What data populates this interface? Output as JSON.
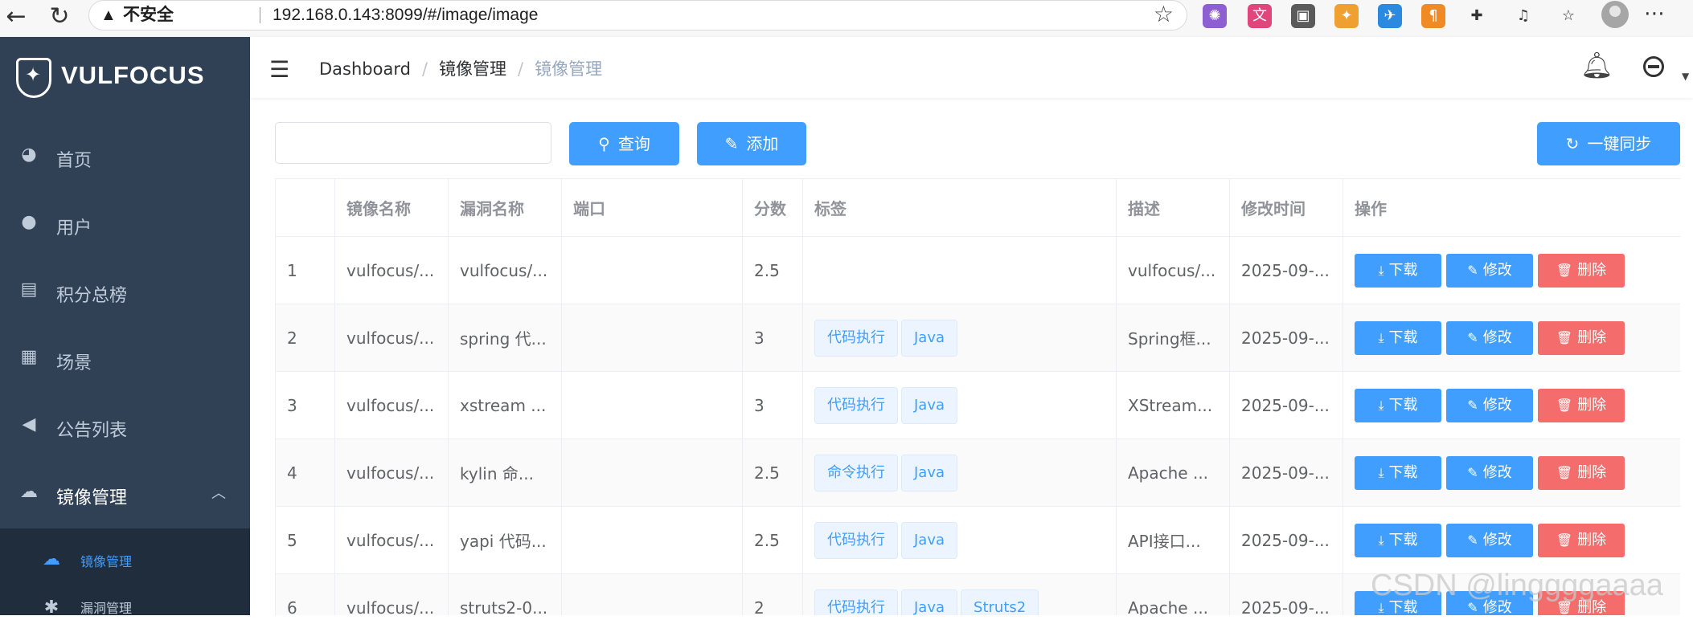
{
  "browser": {
    "insecure_label": "不安全",
    "url": "192.168.0.143:8099/#/image/image"
  },
  "sidebar": {
    "logo_text": "VULFOCUS",
    "items": [
      {
        "label": "首页",
        "icon": "dashboard-icon"
      },
      {
        "label": "用户",
        "icon": "user-icon"
      },
      {
        "label": "积分总榜",
        "icon": "document-icon"
      },
      {
        "label": "场景",
        "icon": "grid-icon"
      },
      {
        "label": "公告列表",
        "icon": "announcement-icon"
      },
      {
        "label": "镜像管理",
        "icon": "docker-icon"
      }
    ],
    "submenu": [
      {
        "label": "镜像管理",
        "icon": "docker-icon"
      },
      {
        "label": "漏洞管理",
        "icon": "bug-icon"
      }
    ]
  },
  "breadcrumb": {
    "home": "Dashboard",
    "parent": "镜像管理",
    "current": "镜像管理",
    "separator": "/"
  },
  "toolbar": {
    "search_value": "",
    "query_label": "查询",
    "add_label": "添加",
    "sync_label": "一键同步"
  },
  "table": {
    "headers": [
      "",
      "镜像名称",
      "漏洞名称",
      "端口",
      "分数",
      "标签",
      "描述",
      "修改时间",
      "操作"
    ],
    "download_label": "下载",
    "edit_label": "修改",
    "delete_label": "删除",
    "rows": [
      {
        "index": "1",
        "image": "vulfocus/...",
        "vuln": "vulfocus/...",
        "port": "",
        "score": "2.5",
        "tags": [],
        "desc": "vulfocus/...",
        "time": "2025-09-..."
      },
      {
        "index": "2",
        "image": "vulfocus/...",
        "vuln": "spring 代...",
        "port": "",
        "score": "3",
        "tags": [
          "代码执行",
          "Java"
        ],
        "desc": "Spring框...",
        "time": "2025-09-..."
      },
      {
        "index": "3",
        "image": "vulfocus/...",
        "vuln": "xstream ...",
        "port": "",
        "score": "3",
        "tags": [
          "代码执行",
          "Java"
        ],
        "desc": "XStream...",
        "time": "2025-09-..."
      },
      {
        "index": "4",
        "image": "vulfocus/...",
        "vuln": "kylin 命...",
        "port": "",
        "score": "2.5",
        "tags": [
          "命令执行",
          "Java"
        ],
        "desc": "Apache ...",
        "time": "2025-09-..."
      },
      {
        "index": "5",
        "image": "vulfocus/...",
        "vuln": "yapi 代码...",
        "port": "",
        "score": "2.5",
        "tags": [
          "代码执行",
          "Java"
        ],
        "desc": "API接口...",
        "time": "2025-09-..."
      },
      {
        "index": "6",
        "image": "vulfocus/...",
        "vuln": "struts2-0...",
        "port": "",
        "score": "2",
        "tags": [
          "代码执行",
          "Java",
          "Struts2"
        ],
        "desc": "Apache ...",
        "time": "2025-09-..."
      }
    ]
  },
  "watermark": "CSDN @linggggaaaa",
  "colors": {
    "sidebar_bg": "#304156",
    "submenu_bg": "#1f2d3d",
    "primary": "#409eff",
    "danger": "#f56c6c"
  }
}
